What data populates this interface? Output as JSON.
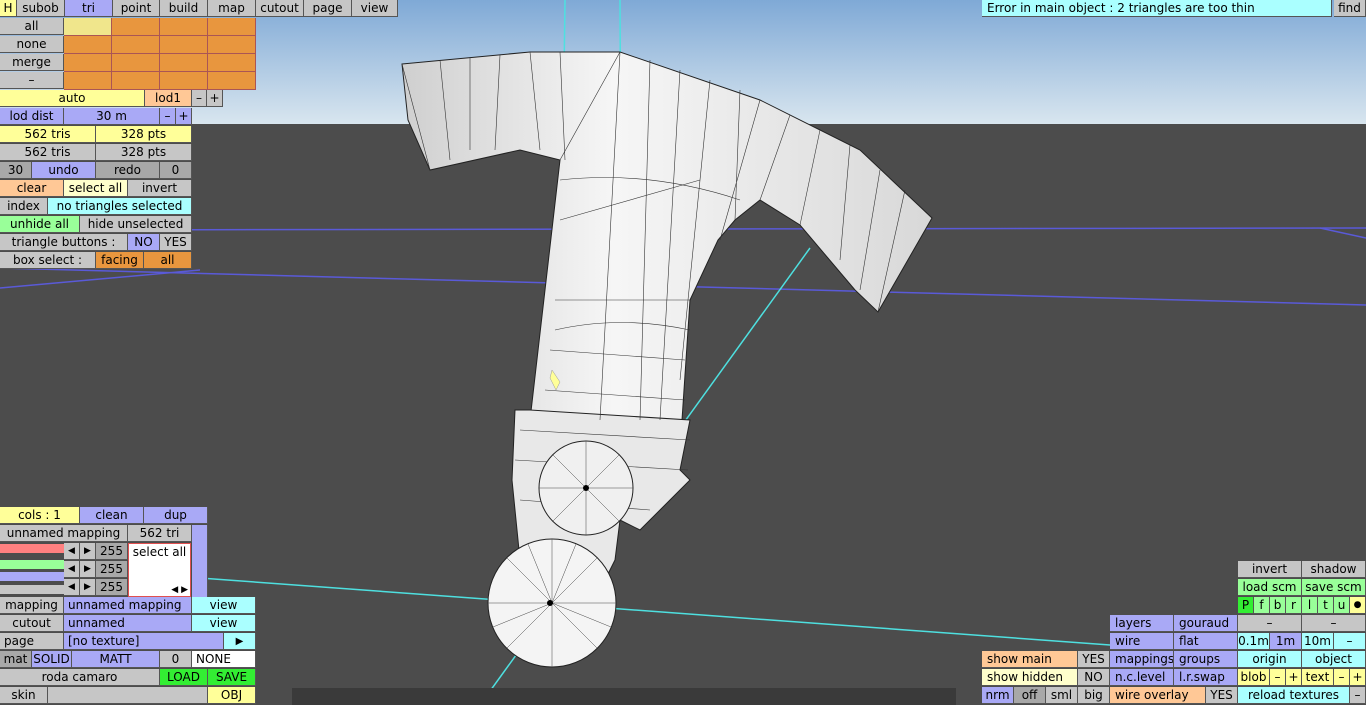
{
  "top_bar": {
    "h": "H",
    "subob": "subob",
    "tri": "tri",
    "point": "point",
    "build": "build",
    "map": "map",
    "cutout": "cutout",
    "page": "page",
    "view": "view"
  },
  "error_text": "Error in main object : 2 triangles are too thin",
  "find": "find",
  "left": {
    "all": "all",
    "none": "none",
    "merge": "merge",
    "minus": "–",
    "auto": "auto",
    "lod1": "lod1",
    "minus_sign": "–",
    "plus_sign": "+",
    "lod_dist": "lod dist",
    "lod_dist_val": "30 m",
    "tris1": "562 tris",
    "pts1": "328 pts",
    "tris2": "562 tris",
    "pts2": "328 pts",
    "undo_count": "30",
    "undo": "undo",
    "redo": "redo",
    "redo_count": "0",
    "clear": "clear",
    "select_all": "select all",
    "invert": "invert",
    "index": "index",
    "no_selected": "no triangles selected",
    "unhide_all": "unhide all",
    "hide_unselected": "hide unselected",
    "tri_buttons": "triangle buttons :",
    "no": "NO",
    "yes": "YES",
    "box_select": "box select :",
    "facing": "facing",
    "box_all": "all"
  },
  "bottom_left": {
    "cols": "cols : 1",
    "clean": "clean",
    "dup": "dup",
    "unnamed_mapping": "unnamed mapping",
    "tri_count": "562 tri",
    "v255a": "255",
    "v255b": "255",
    "v255c": "255",
    "select_all": "select all",
    "mapping": "mapping",
    "mapping_val": "unnamed mapping",
    "view1": "view",
    "cutout": "cutout",
    "cutout_val": "unnamed",
    "view2": "view",
    "page": "page",
    "page_val": "[no texture]",
    "play": "▶",
    "mat": "mat",
    "solid": "SOLID",
    "matt": "MATT",
    "zero": "0",
    "none": "NONE",
    "roda": "roda camaro",
    "load": "LOAD",
    "save": "SAVE",
    "skin": "skin",
    "obj": "OBJ"
  },
  "bottom_center": {
    "show_main": "show main",
    "yes1": "YES",
    "show_hidden": "show hidden",
    "no1": "NO",
    "nrm": "nrm",
    "off": "off",
    "sml": "sml",
    "big": "big"
  },
  "bottom_right": {
    "layers": "layers",
    "gouraud": "gouraud",
    "wire": "wire",
    "flat": "flat",
    "mappings": "mappings",
    "groups": "groups",
    "nclevel": "n.c.level",
    "lrswap": "l.r.swap",
    "wire_overlay": "wire overlay",
    "yes2": "YES",
    "invert": "invert",
    "shadow": "shadow",
    "load_scm": "load scm",
    "save_scm": "save scm",
    "p": "P",
    "f": "f",
    "b": "b",
    "r": "r",
    "l": "l",
    "t": "t",
    "u": "u",
    "dot": "●",
    "dash1": "–",
    "dash2": "–",
    "m01": "0.1m",
    "m1": "1m",
    "m10": "10m",
    "dash3": "–",
    "origin": "origin",
    "object": "object",
    "blob": "blob",
    "bminus": "–",
    "bplus": "+",
    "text": "text",
    "tminus": "–",
    "tplus": "+",
    "reload": "reload textures",
    "rminus": "–"
  }
}
